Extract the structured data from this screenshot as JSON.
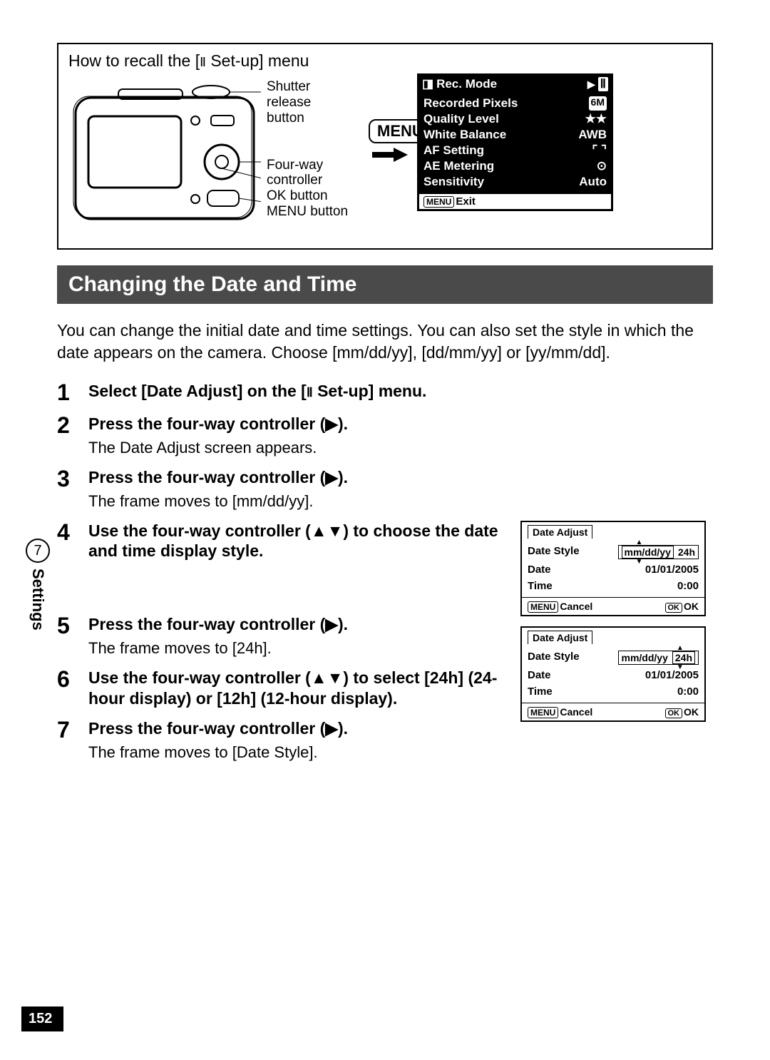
{
  "diagram": {
    "title_prefix": "How to recall the [",
    "title_suffix": " Set-up] menu",
    "callouts": {
      "shutter1": "Shutter",
      "shutter2": "release",
      "shutter3": "button",
      "fourway1": "Four-way",
      "fourway2": "controller",
      "ok": "OK button",
      "menu": "MENU button"
    },
    "menu_button": "MENU"
  },
  "lcd_rec": {
    "title": "Rec. Mode",
    "rows": [
      {
        "label": "Recorded Pixels",
        "value": "6M",
        "pill": true
      },
      {
        "label": "Quality Level",
        "value": "★★"
      },
      {
        "label": "White Balance",
        "value": "AWB"
      },
      {
        "label": "AF Setting",
        "value": "[ ]"
      },
      {
        "label": "AE Metering",
        "value": "◉"
      },
      {
        "label": "Sensitivity",
        "value": "Auto"
      }
    ],
    "footer_btn": "MENU",
    "footer_label": "Exit"
  },
  "section_heading": "Changing the Date and Time",
  "intro": "You can change the initial date and time settings. You can also set the style in which the date appears on the camera. Choose [mm/dd/yy], [dd/mm/yy] or [yy/mm/dd].",
  "steps": [
    {
      "num": "1",
      "title_pre": "Select [Date Adjust] on the [",
      "title_post": " Set-up] menu."
    },
    {
      "num": "2",
      "title": "Press the four-way controller (▶).",
      "sub": "The Date Adjust screen appears."
    },
    {
      "num": "3",
      "title": "Press the four-way controller (▶).",
      "sub": "The frame moves to [mm/dd/yy]."
    },
    {
      "num": "4",
      "title": "Use the four-way controller (▲▼) to choose the date and time display style."
    },
    {
      "num": "5",
      "title": "Press the four-way controller (▶).",
      "sub": "The frame moves to [24h]."
    },
    {
      "num": "6",
      "title": "Use the four-way controller (▲▼) to select [24h] (24-hour display) or [12h] (12-hour display)."
    },
    {
      "num": "7",
      "title": "Press the four-way controller (▶).",
      "sub": "The frame moves to [Date Style]."
    }
  ],
  "lcd_small_a": {
    "title": "Date Adjust",
    "style_label": "Date Style",
    "style_val": "mm/dd/yy",
    "style_val2": "24h",
    "highlight_part": "mmddyy",
    "date_label": "Date",
    "date_val": "01/01/2005",
    "time_label": "Time",
    "time_val": "0:00",
    "cancel_btn": "MENU",
    "cancel": "Cancel",
    "ok_btn": "OK",
    "ok": "OK"
  },
  "lcd_small_b": {
    "title": "Date Adjust",
    "style_label": "Date Style",
    "style_val": "mm/dd/yy",
    "style_val2": "24h",
    "highlight_part": "24h",
    "date_label": "Date",
    "date_val": "01/01/2005",
    "time_label": "Time",
    "time_val": "0:00",
    "cancel_btn": "MENU",
    "cancel": "Cancel",
    "ok_btn": "OK",
    "ok": "OK"
  },
  "side": {
    "num": "7",
    "label": "Settings"
  },
  "page_number": "152"
}
